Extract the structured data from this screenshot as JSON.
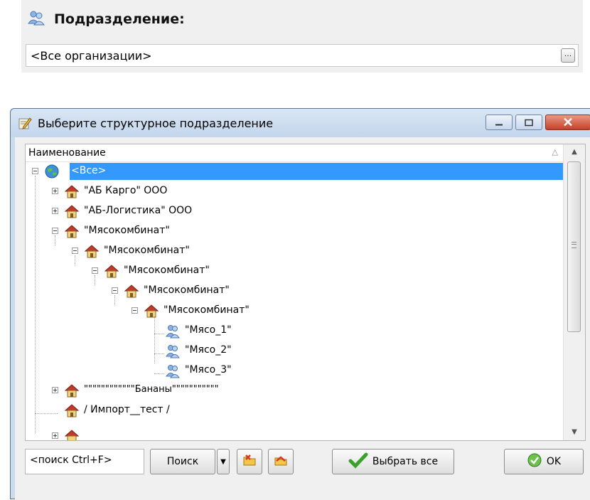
{
  "field": {
    "title": "Подразделение:",
    "value": "<Все организации>",
    "browse_button_label": "...",
    "icon": "users-icon"
  },
  "dialog": {
    "title": "Выберите структурное подразделение",
    "title_icon": "edit-pencil-icon",
    "window_buttons": [
      "minimize",
      "maximize",
      "close"
    ],
    "column_header": "Наименование",
    "sort_indicator": "△",
    "tree": [
      {
        "label": "<Все>",
        "icon": "globe-icon",
        "expanded": true,
        "selected": true,
        "level": 0
      },
      {
        "label": "\"АБ Карго\" ООО",
        "icon": "house-icon",
        "expanded": false,
        "level": 1
      },
      {
        "label": "\"АБ-Логистика\" ООО",
        "icon": "house-icon",
        "expanded": false,
        "level": 1
      },
      {
        "label": "\"Мясокомбинат\"",
        "icon": "house-icon",
        "expanded": true,
        "level": 1
      },
      {
        "label": "\"Мясокомбинат\"",
        "icon": "house-icon",
        "expanded": true,
        "level": 2
      },
      {
        "label": "\"Мясокомбинат\"",
        "icon": "house-icon",
        "expanded": true,
        "level": 3
      },
      {
        "label": "\"Мясокомбинат\"",
        "icon": "house-icon",
        "expanded": true,
        "level": 4
      },
      {
        "label": "\"Мясокомбинат\"",
        "icon": "house-icon",
        "expanded": true,
        "level": 5
      },
      {
        "label": "\"Мясо_1\"",
        "icon": "users-icon",
        "level": 6
      },
      {
        "label": "\"Мясо_2\"",
        "icon": "users-icon",
        "level": 6
      },
      {
        "label": "\"Мясо_3\"",
        "icon": "users-icon",
        "level": 6
      },
      {
        "label": "\"\"\"\"\"\"\"\"\"\"\"\"Бананы\"\"\"\"\"\"\"\"\"\"\"",
        "icon": "house-icon",
        "expanded": false,
        "level": 1
      },
      {
        "label": "/ Импорт__тест /",
        "icon": "house-icon",
        "level": 1
      }
    ],
    "search_placeholder": "<поиск Ctrl+F>",
    "search_button": "Поиск",
    "select_all_button": "Выбрать все",
    "ok_button": "OK"
  }
}
